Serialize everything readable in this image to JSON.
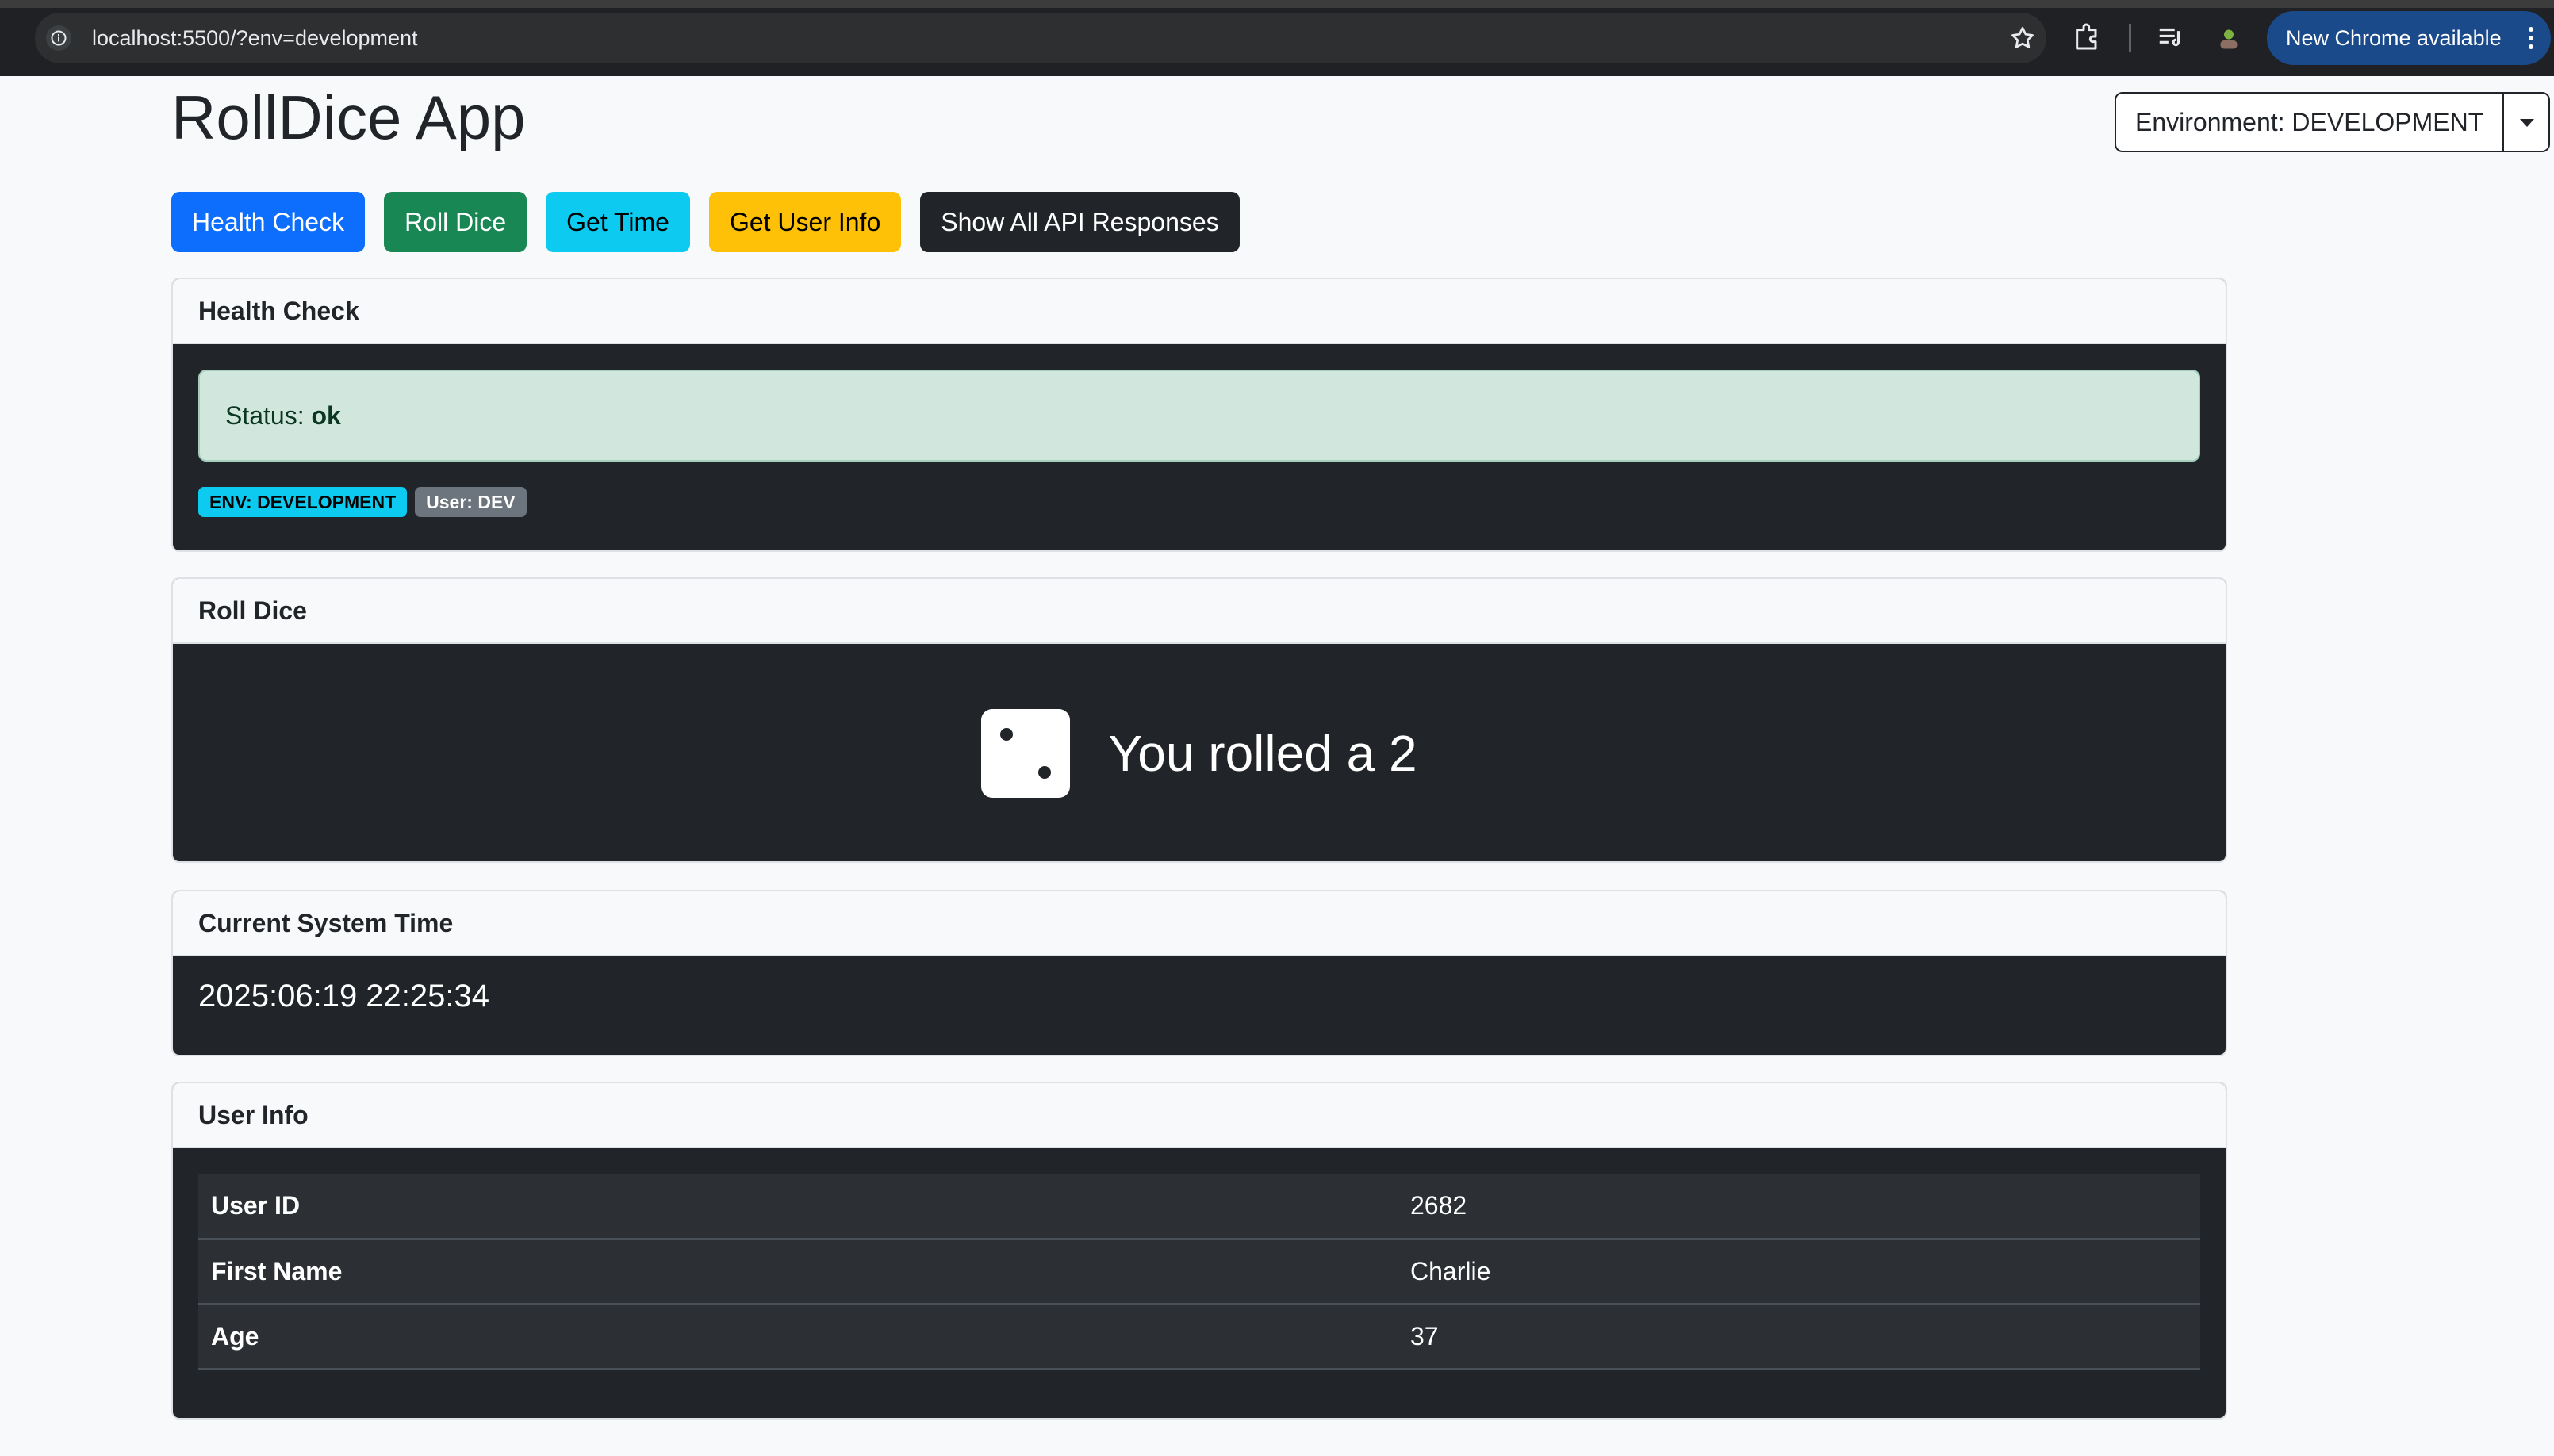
{
  "browser": {
    "url": "localhost:5500/?env=development",
    "update_label": "New Chrome available"
  },
  "page": {
    "title": "RollDice App",
    "environment_label": "Environment: DEVELOPMENT"
  },
  "actions": {
    "health_check": "Health Check",
    "roll_dice": "Roll Dice",
    "get_time": "Get Time",
    "get_user_info": "Get User Info",
    "show_all": "Show All API Responses"
  },
  "health": {
    "header": "Health Check",
    "status_label": "Status: ",
    "status_value": "ok",
    "env_badge": "ENV: DEVELOPMENT",
    "user_badge": "User: DEV"
  },
  "dice": {
    "header": "Roll Dice",
    "result_text": "You rolled a 2",
    "value": 2
  },
  "time": {
    "header": "Current System Time",
    "value": "2025:06:19 22:25:34"
  },
  "user": {
    "header": "User Info",
    "rows": [
      {
        "key": "User ID",
        "value": "2682"
      },
      {
        "key": "First Name",
        "value": "Charlie"
      },
      {
        "key": "Age",
        "value": "37"
      }
    ]
  },
  "colors": {
    "primary": "#0d6efd",
    "success": "#198754",
    "info": "#0dcaf0",
    "warning": "#ffc107",
    "dark": "#212529"
  }
}
